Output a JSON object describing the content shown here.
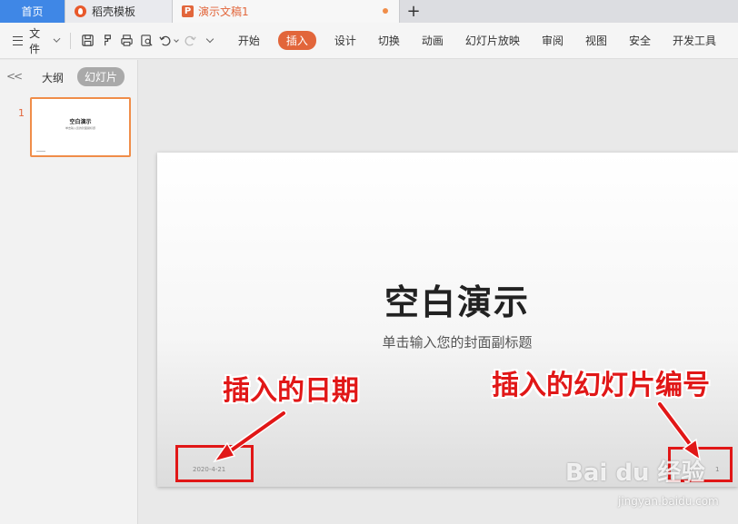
{
  "tabs": {
    "home": "首页",
    "daoke": "稻壳模板",
    "doc": "演示文稿1",
    "doc_icon_letter": "P",
    "add": "+"
  },
  "toolbar": {
    "file_menu": "文件",
    "ribbon_tabs": [
      "开始",
      "插入",
      "设计",
      "切换",
      "动画",
      "幻灯片放映",
      "审阅",
      "视图",
      "安全",
      "开发工具"
    ],
    "active_tab": "插入",
    "quick_icons": [
      "save-icon",
      "format-painter-icon",
      "print-icon",
      "print-preview-icon",
      "undo-icon",
      "redo-icon",
      "more-dropdown-icon"
    ]
  },
  "left_panel": {
    "collapse": "<<",
    "tab_outline": "大纲",
    "tab_slides": "幻灯片",
    "slide_number": "1",
    "thumb_title": "空白演示",
    "thumb_subtitle": "单击输入您的封面副标题"
  },
  "slide": {
    "title": "空白演示",
    "subtitle": "单击输入您的封面副标题",
    "date": "2020-4-21",
    "number": "1"
  },
  "annotations": {
    "date_label": "插入的日期",
    "number_label": "插入的幻灯片编号",
    "color": "#e11717"
  },
  "watermark": {
    "brand": "Bai du 经验",
    "url": "jingyan.baidu.com"
  },
  "colors": {
    "accent": "#e2663b",
    "home_tab": "#3f87e6"
  }
}
